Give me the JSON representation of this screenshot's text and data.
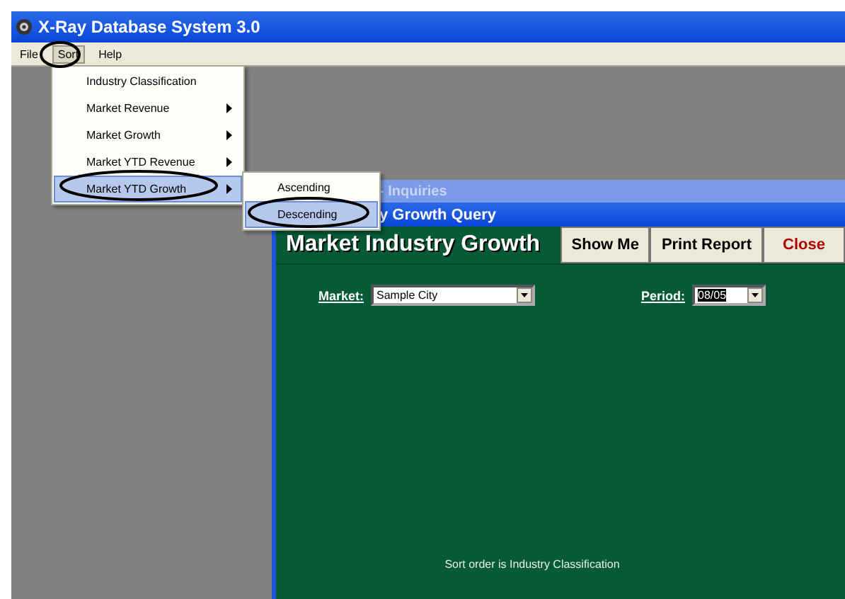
{
  "window": {
    "title": "X-Ray Database System 3.0"
  },
  "menu_bar": [
    {
      "label": "File",
      "selected": false
    },
    {
      "label": "Sort",
      "selected": true
    },
    {
      "label": "Help",
      "selected": false
    }
  ],
  "sort_menu": [
    {
      "label": "Industry Classification",
      "submenu": false,
      "selected": false
    },
    {
      "label": "Market Revenue",
      "submenu": true,
      "selected": false
    },
    {
      "label": "Market Growth",
      "submenu": true,
      "selected": false
    },
    {
      "label": "Market YTD Revenue",
      "submenu": true,
      "selected": false
    },
    {
      "label": "Market YTD Growth",
      "submenu": true,
      "selected": true
    }
  ],
  "submenu": [
    {
      "label": "Ascending",
      "selected": false
    },
    {
      "label": "Descending",
      "selected": true
    }
  ],
  "back_window": {
    "title": "- Inquiries"
  },
  "front_window": {
    "title": "y Growth Query",
    "heading": "Market Industry Growth",
    "buttons": [
      {
        "label": "Show Me",
        "kind": "normal"
      },
      {
        "label": "Print Report",
        "kind": "normal"
      },
      {
        "label": "Close",
        "kind": "danger"
      }
    ],
    "market": {
      "label": "Market:",
      "value": "Sample City"
    },
    "period": {
      "label": "Period:",
      "value": "08/05"
    },
    "status": "Sort order is Industry Classification"
  }
}
